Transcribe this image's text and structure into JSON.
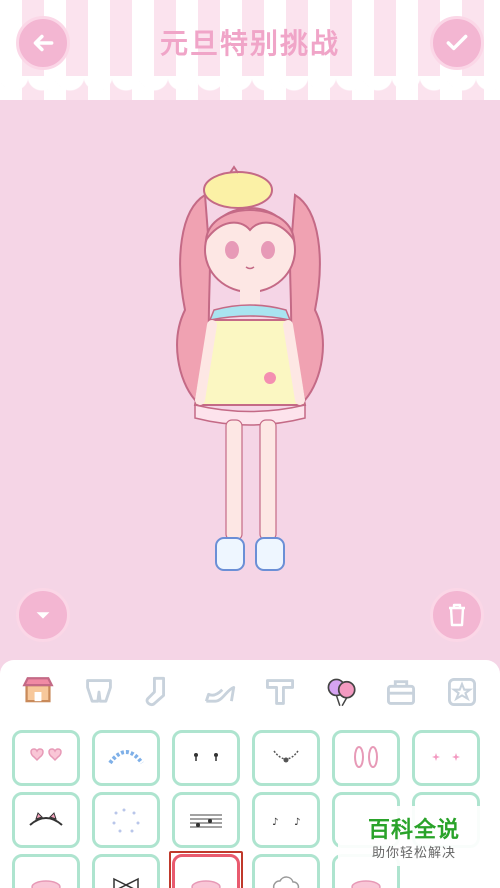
{
  "header": {
    "title": "元旦特别挑战"
  },
  "buttons": {
    "back_icon": "arrow-left-icon",
    "confirm_icon": "check-icon",
    "collapse_icon": "chevron-down-icon",
    "delete_icon": "trash-icon"
  },
  "category_tabs": [
    {
      "name": "shop",
      "icon": "shop-icon",
      "active": true
    },
    {
      "name": "bottoms",
      "icon": "shorts-icon"
    },
    {
      "name": "socks",
      "icon": "sock-icon"
    },
    {
      "name": "shoes",
      "icon": "high-heel-icon"
    },
    {
      "name": "tops",
      "icon": "shirt-icon"
    },
    {
      "name": "accessories",
      "icon": "balloon-icon"
    },
    {
      "name": "bags",
      "icon": "bag-icon"
    },
    {
      "name": "favorites",
      "icon": "star-icon"
    }
  ],
  "items": [
    {
      "icon": "heart-glasses-icon"
    },
    {
      "icon": "flower-headband-icon"
    },
    {
      "icon": "drop-earrings-icon"
    },
    {
      "icon": "necklace-icon"
    },
    {
      "icon": "bunny-ears-icon"
    },
    {
      "icon": "sparkle-earrings-icon"
    },
    {
      "icon": "cat-ears-headband-icon"
    },
    {
      "icon": "dots-halo-icon"
    },
    {
      "icon": "music-notes-icon"
    },
    {
      "icon": "note-earrings-icon"
    },
    {
      "icon": "blank-item-icon"
    },
    {
      "icon": "blank-item-icon"
    },
    {
      "icon": "hat-item-icon"
    },
    {
      "icon": "bow-item-icon"
    },
    {
      "icon": "hat-item-icon",
      "selected": true
    },
    {
      "icon": "cloud-item-icon"
    },
    {
      "icon": "hat-item-icon"
    }
  ],
  "watermark": {
    "title": "百科全说",
    "subtitle": "助你轻松解决"
  },
  "colors": {
    "background": "#f5d5e6",
    "accent_pink": "#f0a5c8",
    "item_border": "#aee4cf",
    "selected": "#c0392b"
  }
}
